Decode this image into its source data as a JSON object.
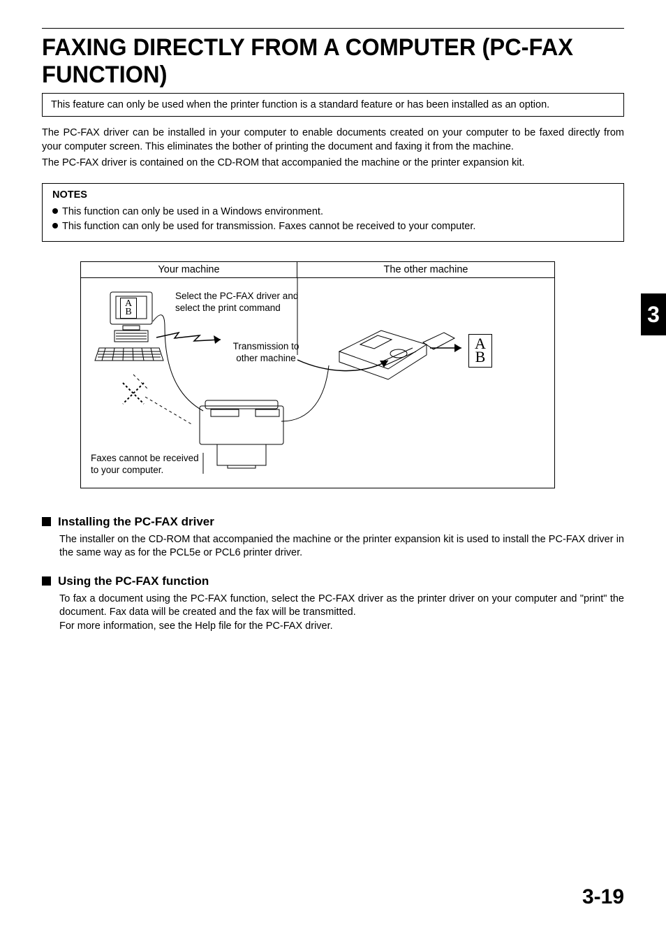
{
  "title": "FAXING DIRECTLY FROM A COMPUTER (PC-FAX FUNCTION)",
  "info_box": "This feature can only be used when the printer function is a standard feature or has been installed as an option.",
  "intro_p1": "The PC-FAX driver can be installed in your computer to enable documents created on your computer to be faxed directly from your computer screen. This eliminates the bother of printing the document and faxing it from the machine.",
  "intro_p2": "The PC-FAX driver is contained on the CD-ROM that accompanied the machine or the printer expansion kit.",
  "notes": {
    "heading": "NOTES",
    "items": [
      "This function can only be used in a Windows environment.",
      "This function can only be used for transmission. Faxes cannot be received to your computer."
    ]
  },
  "diagram": {
    "left_header": "Your machine",
    "right_header": "The other machine",
    "txt_select": "Select the PC-FAX driver and select the print command",
    "txt_transmission_l1": "Transmission to",
    "txt_transmission_l2": "other machine",
    "txt_noreceive_l1": "Faxes cannot be received",
    "txt_noreceive_l2": "to your computer.",
    "ab_a": "A",
    "ab_b": "B"
  },
  "sections": [
    {
      "heading": "Installing the PC-FAX driver",
      "body": "The installer on the CD-ROM that accompanied the machine or the printer expansion kit is used to install the PC-FAX driver in the same way as for the PCL5e or PCL6 printer driver."
    },
    {
      "heading": "Using the PC-FAX function",
      "body": "To fax a document using the PC-FAX function, select the PC-FAX driver as the printer driver on your computer and \"print\" the document. Fax data will be created and the fax will be transmitted.\nFor more information, see the Help file for the PC-FAX driver."
    }
  ],
  "chapter_tab": "3",
  "page_number": "3-19"
}
